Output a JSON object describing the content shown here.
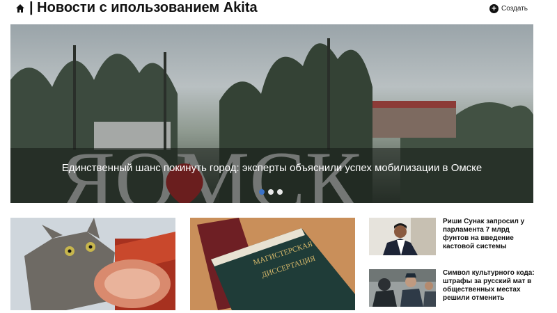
{
  "header": {
    "home_icon": "home-icon",
    "title": "| Новости с ипользованием Akita",
    "create_label": "Создать",
    "create_icon": "plus-circle-icon"
  },
  "hero": {
    "sign_text": "ЯОМСК",
    "caption": "Единственный шанс покинуть город: эксперты объяснили успех мобилизации в Омске",
    "slides": 3,
    "active_slide": 1
  },
  "cards": [
    {
      "image": "cat-eating-ham-photo"
    },
    {
      "image": "masters-dissertation-book-photo",
      "book_text": [
        "МАГИСТЕРСКАЯ",
        "ДИССЕРТАЦИЯ"
      ]
    }
  ],
  "side_news": [
    {
      "title": "Риши Сунак запросил у парламента 7 млрд фунтов на введение кастовой системы",
      "image": "man-in-suit-photo"
    },
    {
      "title": "Символ культурного кода: штрафы за русский мат в общественных местах решили отменить",
      "image": "police-crowd-photo"
    }
  ],
  "colors": {
    "accent": "#3b73c9",
    "text": "#111111"
  }
}
